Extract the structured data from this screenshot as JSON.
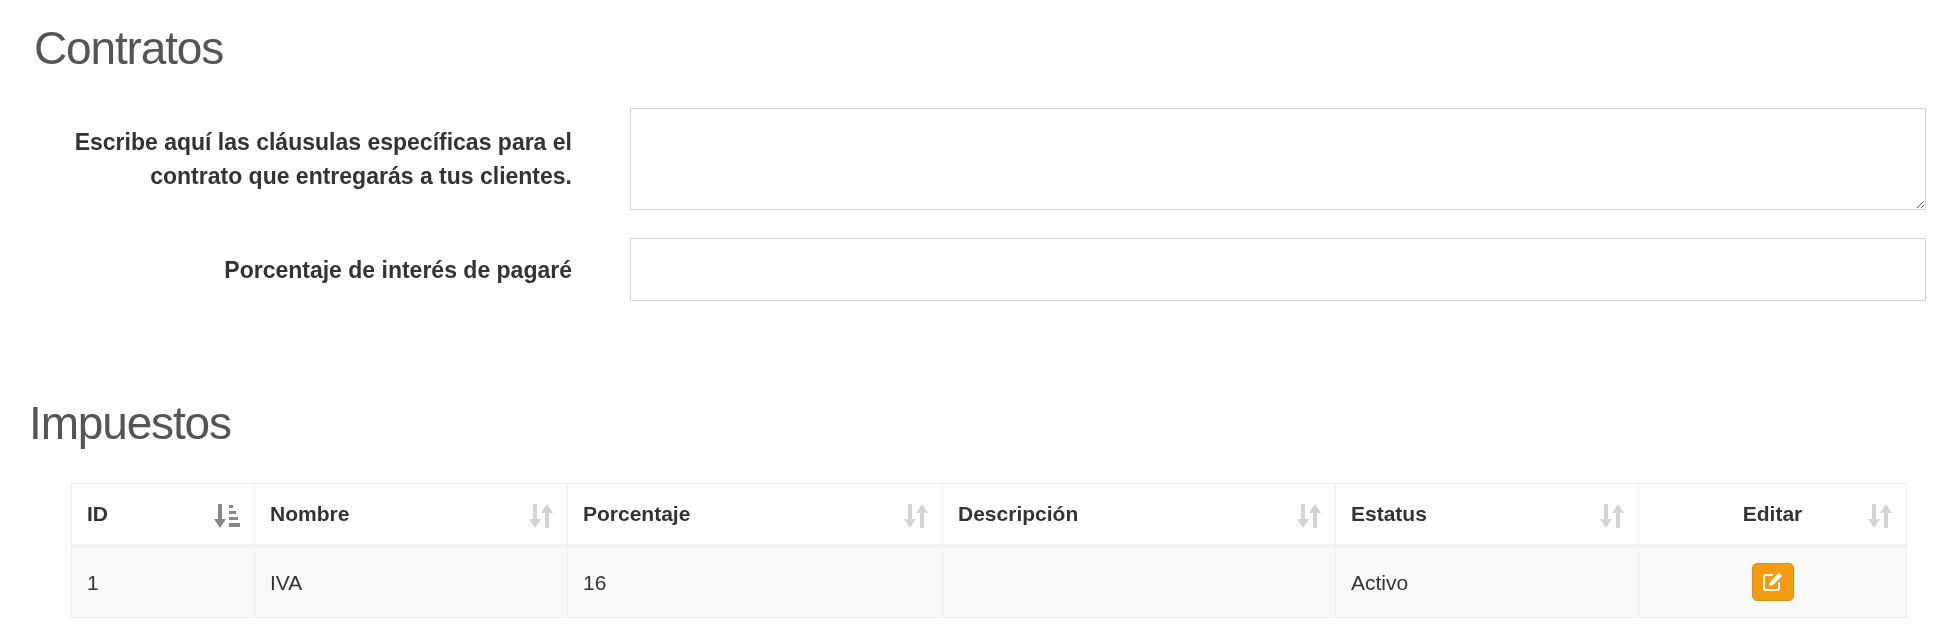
{
  "contratos": {
    "title": "Contratos",
    "fields": [
      {
        "kind": "textarea",
        "label": "Escribe aquí las cláusulas específicas para el contrato que entregarás a tus clientes."
      },
      {
        "kind": "input",
        "label": "Porcentaje de interés de pagaré"
      }
    ]
  },
  "impuestos": {
    "title": "Impuestos",
    "table": {
      "columns": [
        {
          "label": "ID",
          "sorted": true
        },
        {
          "label": "Nombre",
          "sorted": false
        },
        {
          "label": "Porcentaje",
          "sorted": false
        },
        {
          "label": "Descripción",
          "sorted": false
        },
        {
          "label": "Estatus",
          "sorted": false
        },
        {
          "label": "Editar",
          "sorted": false
        }
      ],
      "rows": [
        {
          "cells": [
            "1",
            "IVA",
            "16",
            "",
            "Activo"
          ],
          "editable": true
        }
      ]
    }
  }
}
